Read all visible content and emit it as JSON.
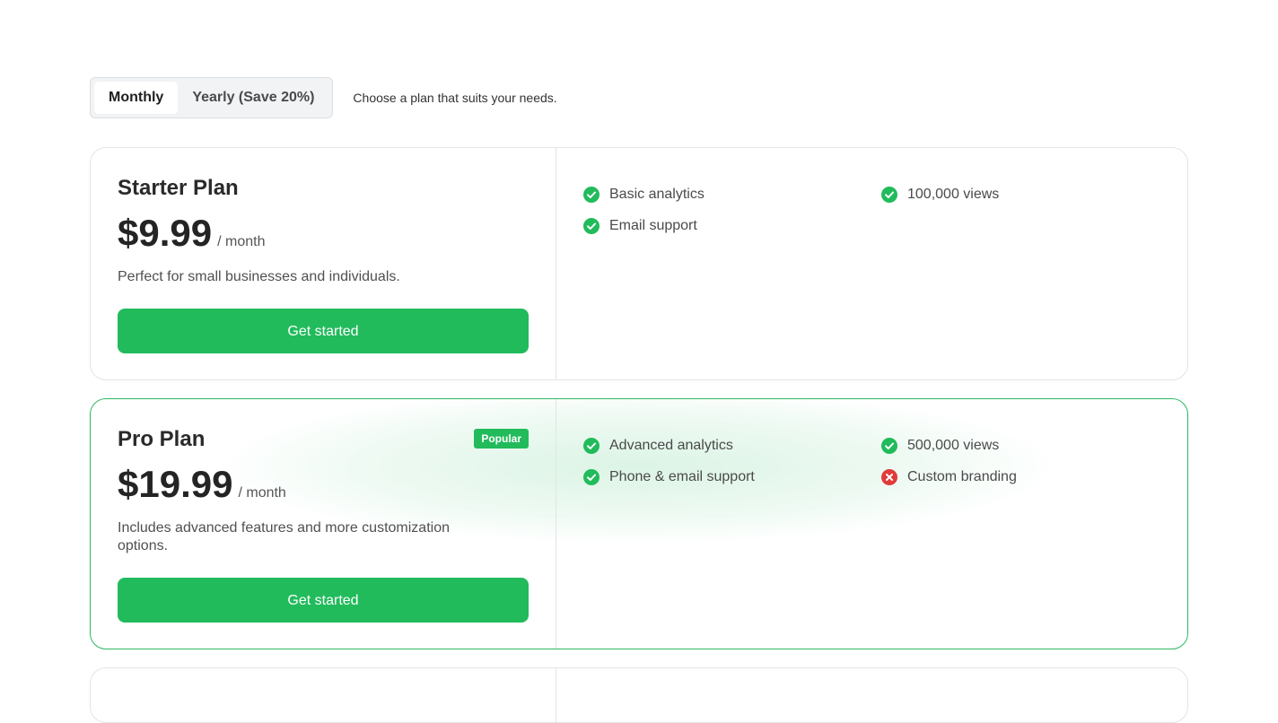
{
  "billing_toggle": {
    "options": [
      {
        "label": "Monthly",
        "active": true
      },
      {
        "label": "Yearly (Save 20%)",
        "active": false
      }
    ],
    "caption": "Choose a plan that suits your needs."
  },
  "colors": {
    "accent": "#22bb5c",
    "included": "#22bb5c",
    "excluded": "#e03b3b"
  },
  "plans": [
    {
      "name": "Starter Plan",
      "price": "$9.99",
      "period": "/ month",
      "description": "Perfect for small businesses and individuals.",
      "cta": "Get started",
      "badge": "",
      "features": [
        {
          "label": "Basic analytics",
          "included": true,
          "icon": "check-circle-icon"
        },
        {
          "label": "100,000 views",
          "included": true,
          "icon": "check-circle-icon"
        },
        {
          "label": "Email support",
          "included": true,
          "icon": "check-circle-icon"
        }
      ]
    },
    {
      "name": "Pro Plan",
      "price": "$19.99",
      "period": "/ month",
      "description": "Includes advanced features and more customization options.",
      "cta": "Get started",
      "badge": "Popular",
      "features": [
        {
          "label": "Advanced analytics",
          "included": true,
          "icon": "check-circle-icon"
        },
        {
          "label": "500,000 views",
          "included": true,
          "icon": "check-circle-icon"
        },
        {
          "label": "Phone & email support",
          "included": true,
          "icon": "check-circle-icon"
        },
        {
          "label": "Custom branding",
          "included": false,
          "icon": "x-circle-icon"
        }
      ]
    }
  ]
}
